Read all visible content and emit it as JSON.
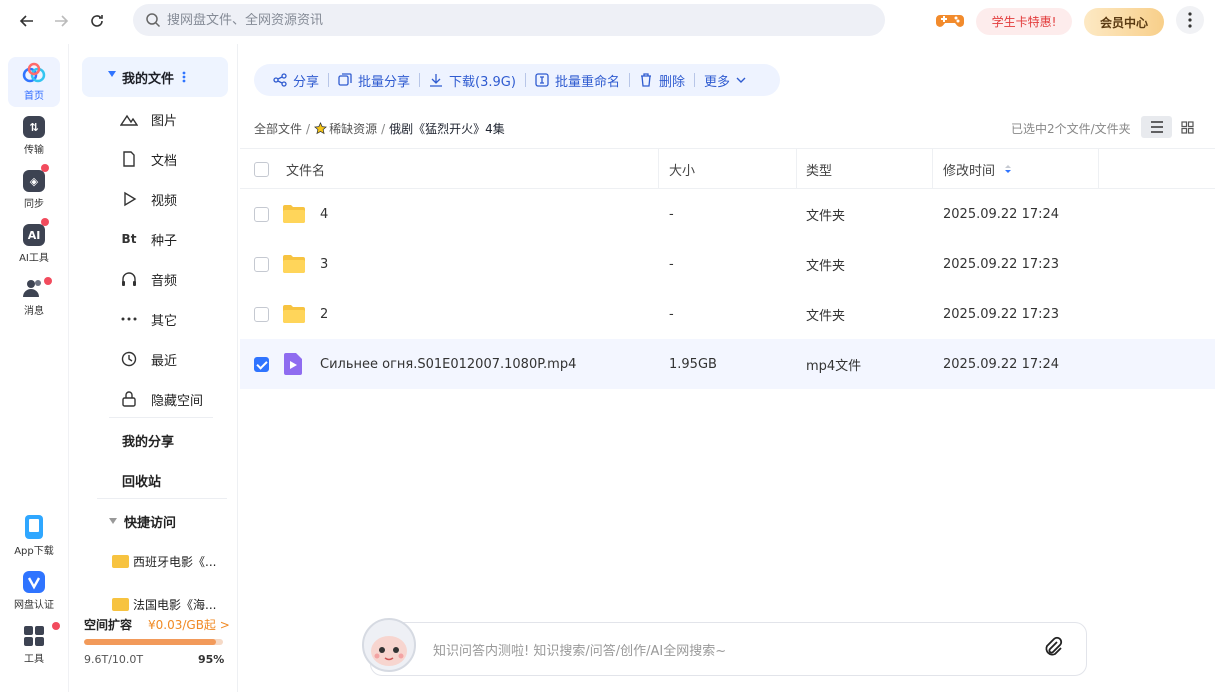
{
  "topbar": {
    "search_placeholder": "搜网盘文件、全网资源资讯",
    "student_badge": "学生卡特惠!",
    "vip_label": "会员中心",
    "back_icon": "arrow-left-icon",
    "forward_icon": "arrow-right-icon",
    "refresh_icon": "refresh-icon"
  },
  "rail": {
    "home": "首页",
    "transfer": "传输",
    "sync": "同步",
    "ai": "AI工具",
    "message": "消息",
    "app_download": "App下载",
    "verify": "网盘认证",
    "tools": "工具"
  },
  "sidebar": {
    "my_files": "我的文件",
    "items": [
      {
        "label": "图片",
        "icon": "mountain-icon"
      },
      {
        "label": "文档",
        "icon": "document-icon"
      },
      {
        "label": "视频",
        "icon": "play-icon"
      },
      {
        "label": "种子",
        "icon": "bt-icon"
      },
      {
        "label": "音频",
        "icon": "headphones-icon"
      },
      {
        "label": "其它",
        "icon": "more-dots-icon"
      },
      {
        "label": "最近",
        "icon": "clock-icon"
      },
      {
        "label": "隐藏空间",
        "icon": "lock-icon"
      }
    ],
    "my_share": "我的分享",
    "recycle": "回收站",
    "quick_access": "快捷访问",
    "quick_items": [
      "西班牙电影《...",
      "法国电影《海..."
    ],
    "storage": {
      "label": "空间扩容",
      "price": "¥0.03/GB起 >",
      "used": "9.6T/10.0T",
      "percent_text": "95%",
      "fraction": 0.95
    }
  },
  "toolbar": {
    "share": "分享",
    "batch_share": "批量分享",
    "download": "下载(3.9G)",
    "batch_rename": "批量重命名",
    "delete": "删除",
    "more": "更多"
  },
  "breadcrumb": {
    "all": "全部文件",
    "rare": "稀缺资源",
    "current": "俄剧《猛烈开火》4集"
  },
  "selection_info": "已选中2个文件/文件夹",
  "table": {
    "headers": {
      "name": "文件名",
      "size": "大小",
      "type": "类型",
      "modified": "修改时间"
    },
    "rows": [
      {
        "name": "4",
        "size": "-",
        "type": "文件夹",
        "modified": "2025.09.22 17:24",
        "kind": "folder",
        "selected": false
      },
      {
        "name": "3",
        "size": "-",
        "type": "文件夹",
        "modified": "2025.09.22 17:23",
        "kind": "folder",
        "selected": false
      },
      {
        "name": "2",
        "size": "-",
        "type": "文件夹",
        "modified": "2025.09.22 17:23",
        "kind": "folder",
        "selected": false
      },
      {
        "name": "Сильнее огня.S01E012007.1080P.mp4",
        "size": "1.95GB",
        "type": "mp4文件",
        "modified": "2025.09.22 17:24",
        "kind": "video",
        "selected": true
      }
    ]
  },
  "ai_bar": {
    "placeholder": "知识问答内测啦! 知识搜索/问答/创作/AI全网搜索~"
  },
  "colors": {
    "accent": "#2f74ff",
    "folder": "#f7c340",
    "video": "#8f6cf0",
    "storage": "#f29a5a"
  }
}
